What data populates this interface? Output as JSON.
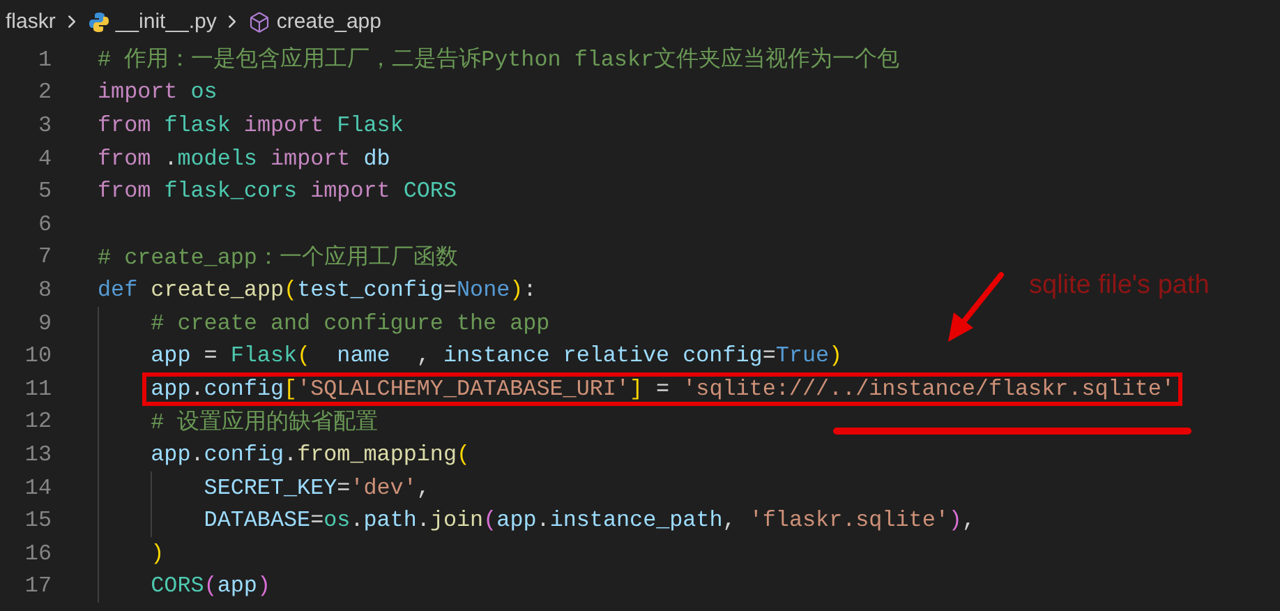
{
  "breadcrumb": [
    {
      "label": "flaskr",
      "kind": "folder"
    },
    {
      "label": "__init__.py",
      "kind": "python"
    },
    {
      "label": "create_app",
      "kind": "method"
    }
  ],
  "lines": [
    {
      "number": "1",
      "highlighted": false,
      "tokens": [
        {
          "kind": "comment",
          "text": "# 作用：一是包含应用工厂，二是告诉Python flaskr文件夹应当视作为一个包"
        }
      ]
    },
    {
      "number": "2",
      "highlighted": false,
      "tokens": [
        {
          "kind": "kw",
          "text": "import "
        },
        {
          "kind": "mod",
          "text": "os"
        }
      ]
    },
    {
      "number": "3",
      "highlighted": false,
      "tokens": [
        {
          "kind": "kw",
          "text": "from "
        },
        {
          "kind": "mod",
          "text": "flask "
        },
        {
          "kind": "kw",
          "text": "import "
        },
        {
          "kind": "mod",
          "text": "Flask"
        }
      ]
    },
    {
      "number": "4",
      "highlighted": false,
      "tokens": [
        {
          "kind": "kw",
          "text": "from "
        },
        {
          "kind": "plain",
          "text": "."
        },
        {
          "kind": "mod",
          "text": "models "
        },
        {
          "kind": "kw",
          "text": "import "
        },
        {
          "kind": "var",
          "text": "db"
        }
      ]
    },
    {
      "number": "5",
      "highlighted": false,
      "tokens": [
        {
          "kind": "kw",
          "text": "from "
        },
        {
          "kind": "mod",
          "text": "flask_cors "
        },
        {
          "kind": "kw",
          "text": "import "
        },
        {
          "kind": "mod",
          "text": "CORS"
        }
      ]
    },
    {
      "number": "6"
    },
    {
      "number": "7",
      "highlighted": false,
      "tokens": [
        {
          "kind": "comment",
          "text": "# create_app：一个应用工厂函数"
        }
      ]
    },
    {
      "number": "8",
      "highlighted": false,
      "tokens": [
        {
          "kind": "def",
          "text": "def "
        },
        {
          "kind": "fn",
          "text": "create_app"
        },
        {
          "kind": "br1",
          "text": "("
        },
        {
          "kind": "var",
          "text": "test_config"
        },
        {
          "kind": "plain",
          "text": "="
        },
        {
          "kind": "def",
          "text": "None"
        },
        {
          "kind": "br1",
          "text": ")"
        },
        {
          "kind": "plain",
          "text": ":"
        }
      ],
      "children": [
        {
          "number": "9",
          "highlighted": false,
          "tokens": [
            {
              "kind": "comment",
              "text": "# create and configure the app"
            }
          ]
        },
        {
          "number": "10",
          "highlighted": false,
          "tokens": [
            {
              "kind": "var",
              "text": "app"
            },
            {
              "kind": "plain",
              "text": " = "
            },
            {
              "kind": "mod",
              "text": "Flask"
            },
            {
              "kind": "br1",
              "text": "("
            },
            {
              "kind": "var",
              "text": "  name  "
            },
            {
              "kind": "plain",
              "text": ", "
            },
            {
              "kind": "var",
              "text": "instance relative config"
            },
            {
              "kind": "plain",
              "text": "="
            },
            {
              "kind": "def",
              "text": "True"
            },
            {
              "kind": "br1",
              "text": ")"
            }
          ]
        },
        {
          "number": "11",
          "highlighted": true,
          "tokens": [
            {
              "kind": "var",
              "text": "app"
            },
            {
              "kind": "plain",
              "text": "."
            },
            {
              "kind": "var",
              "text": "config"
            },
            {
              "kind": "br1",
              "text": "["
            },
            {
              "kind": "str",
              "text": "'SQLALCHEMY_DATABASE_URI'"
            },
            {
              "kind": "br1",
              "text": "]"
            },
            {
              "kind": "plain",
              "text": " = "
            },
            {
              "kind": "str",
              "text": "'sqlite:///../instance/flaskr.sqlite'"
            }
          ]
        },
        {
          "number": "12",
          "highlighted": false,
          "tokens": [
            {
              "kind": "comment",
              "text": "# 设置应用的缺省配置"
            }
          ]
        },
        {
          "number": "13",
          "highlighted": false,
          "tokens": [
            {
              "kind": "var",
              "text": "app"
            },
            {
              "kind": "plain",
              "text": "."
            },
            {
              "kind": "var",
              "text": "config"
            },
            {
              "kind": "plain",
              "text": "."
            },
            {
              "kind": "fn",
              "text": "from_mapping"
            },
            {
              "kind": "br1",
              "text": "("
            }
          ],
          "children": [
            {
              "number": "14",
              "highlighted": false,
              "tokens": [
                {
                  "kind": "var",
                  "text": "SECRET_KEY"
                },
                {
                  "kind": "plain",
                  "text": "="
                },
                {
                  "kind": "str",
                  "text": "'dev'"
                },
                {
                  "kind": "plain",
                  "text": ","
                }
              ]
            },
            {
              "number": "15",
              "highlighted": false,
              "tokens": [
                {
                  "kind": "var",
                  "text": "DATABASE"
                },
                {
                  "kind": "plain",
                  "text": "="
                },
                {
                  "kind": "mod",
                  "text": "os"
                },
                {
                  "kind": "plain",
                  "text": "."
                },
                {
                  "kind": "var",
                  "text": "path"
                },
                {
                  "kind": "plain",
                  "text": "."
                },
                {
                  "kind": "fn",
                  "text": "join"
                },
                {
                  "kind": "br2",
                  "text": "("
                },
                {
                  "kind": "var",
                  "text": "app"
                },
                {
                  "kind": "plain",
                  "text": "."
                },
                {
                  "kind": "var",
                  "text": "instance_path"
                },
                {
                  "kind": "plain",
                  "text": ", "
                },
                {
                  "kind": "str",
                  "text": "'flaskr.sqlite'"
                },
                {
                  "kind": "br2",
                  "text": ")"
                },
                {
                  "kind": "plain",
                  "text": ","
                }
              ]
            }
          ]
        },
        {
          "number": "16",
          "highlighted": false,
          "tokens": [
            {
              "kind": "br1",
              "text": ")"
            }
          ]
        },
        {
          "number": "17",
          "highlighted": false,
          "tokens": [
            {
              "kind": "mod",
              "text": "CORS"
            },
            {
              "kind": "br2",
              "text": "("
            },
            {
              "kind": "var",
              "text": "app"
            },
            {
              "kind": "br2",
              "text": ")"
            }
          ]
        }
      ]
    }
  ],
  "annotation": {
    "label": "sqlite file's path"
  }
}
